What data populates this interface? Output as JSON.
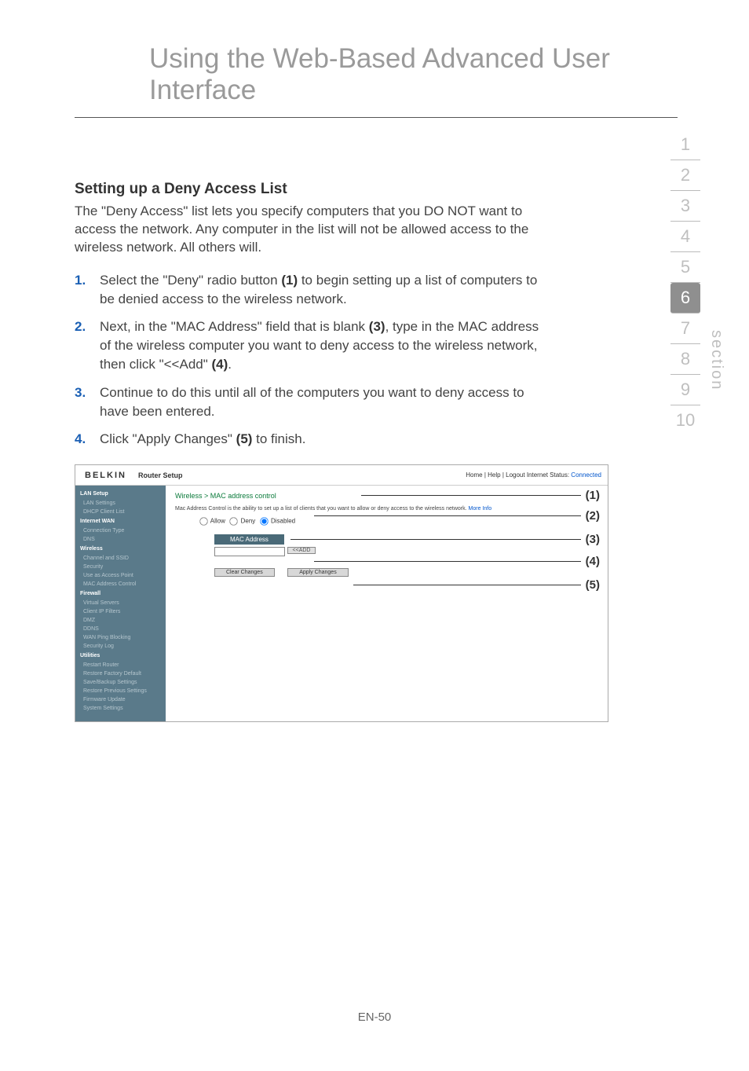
{
  "page_title": "Using the Web-Based Advanced User Interface",
  "heading": "Setting up a Deny Access List",
  "intro": "The \"Deny Access\" list lets you specify computers that you DO NOT want to access the network. Any computer in the list will not be allowed access to the wireless network. All others will.",
  "steps": [
    {
      "num": "1.",
      "pre": "Select the \"Deny\" radio button ",
      "bold": "(1)",
      "post": " to begin setting up a list of computers to be denied access to the wireless network."
    },
    {
      "num": "2.",
      "pre": "Next, in the \"MAC Address\" field that is blank ",
      "bold": "(3)",
      "post": ", type in the MAC address of the wireless computer you want to deny access to the wireless network, then click \"<<Add\" ",
      "bold2": "(4)",
      "post2": "."
    },
    {
      "num": "3.",
      "pre": "Continue to do this until all of the computers you want to deny access to have been entered.",
      "bold": "",
      "post": ""
    },
    {
      "num": "4.",
      "pre": "Click \"Apply Changes\" ",
      "bold": "(5)",
      "post": " to finish."
    }
  ],
  "section_nav": [
    "1",
    "2",
    "3",
    "4",
    "5",
    "6",
    "7",
    "8",
    "9",
    "10"
  ],
  "section_active": "6",
  "section_label": "section",
  "footer": "EN-50",
  "screenshot": {
    "logo": "BELKIN",
    "router_setup": "Router Setup",
    "toplinks_left": "Home | Help | Logout   Internet Status: ",
    "toplinks_status": "Connected",
    "breadcrumb": "Wireless > MAC address control",
    "desc_pre": "Mac Address Control is the ability to set up a list of clients that you want to allow or deny access to the wireless network. ",
    "desc_more": "More Info",
    "radio_allow": "Allow",
    "radio_deny": "Deny",
    "radio_disabled": "Disabled",
    "mac_header": "MAC Address",
    "add_btn": "<<ADD",
    "clear_btn": "Clear Changes",
    "apply_btn": "Apply Changes",
    "sidebar": {
      "groups": [
        {
          "header": "LAN Setup",
          "items": [
            "LAN Settings",
            "DHCP Client List"
          ]
        },
        {
          "header": "Internet WAN",
          "items": [
            "Connection Type",
            "DNS"
          ]
        },
        {
          "header": "Wireless",
          "items": [
            "Channel and SSID",
            "Security",
            "Use as Access Point",
            "MAC Address Control"
          ]
        },
        {
          "header": "Firewall",
          "items": [
            "Virtual Servers",
            "Client IP Filters",
            "DMZ",
            "DDNS",
            "WAN Ping Blocking",
            "Security Log"
          ]
        },
        {
          "header": "Utilities",
          "items": [
            "Restart Router",
            "Restore Factory Default",
            "Save/Backup Settings",
            "Restore Previous Settings",
            "Firmware Update",
            "System Settings"
          ]
        }
      ]
    },
    "callouts": [
      "(1)",
      "(2)",
      "(3)",
      "(4)",
      "(5)"
    ]
  }
}
